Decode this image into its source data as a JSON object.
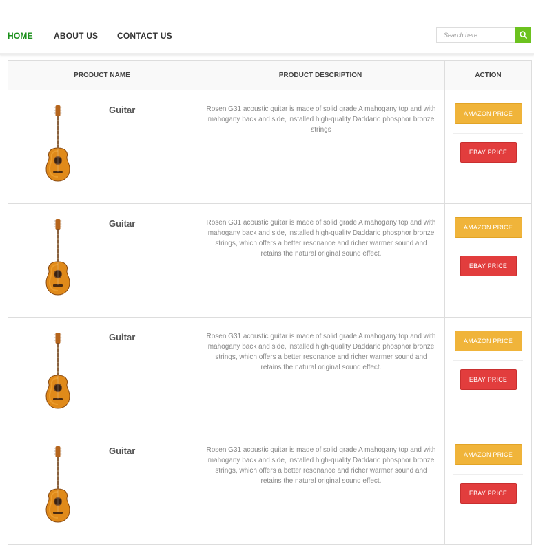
{
  "nav": {
    "items": [
      {
        "label": "HOME",
        "active": true
      },
      {
        "label": "ABOUT US",
        "active": false
      },
      {
        "label": "CONTACT US",
        "active": false
      }
    ],
    "search": {
      "placeholder": "Search here",
      "icon": "search-icon"
    },
    "colors": {
      "active": "#1a8f1a",
      "search_button": "#6cc21f"
    }
  },
  "table": {
    "headers": [
      "PRODUCT NAME",
      "PRODUCT DESCRIPTION",
      "ACTION"
    ],
    "rows": [
      {
        "name": "Guitar",
        "image": "acoustic-guitar-image",
        "description": "Rosen G31 acoustic guitar is made of solid grade A mahogany top and with mahogany back and side, installed high-quality Daddario phosphor bronze strings",
        "amazon_label": "AMAZON PRICE",
        "ebay_label": "EBAY PRICE"
      },
      {
        "name": "Guitar",
        "image": "acoustic-guitar-image",
        "description": "Rosen G31 acoustic guitar is made of solid grade A mahogany top and with mahogany back and side, installed high-quality Daddario phosphor bronze strings, which offers a better resonance and richer warmer sound and retains the natural original sound effect.",
        "amazon_label": "AMAZON PRICE",
        "ebay_label": "EBAY PRICE"
      },
      {
        "name": "Guitar",
        "image": "acoustic-guitar-image",
        "description": "Rosen G31 acoustic guitar is made of solid grade A mahogany top and with mahogany back and side, installed high-quality Daddario phosphor bronze strings, which offers a better resonance and richer warmer sound and retains the natural original sound effect.",
        "amazon_label": "AMAZON PRICE",
        "ebay_label": "EBAY PRICE"
      },
      {
        "name": "Guitar",
        "image": "acoustic-guitar-image",
        "description": "Rosen G31 acoustic guitar is made of solid grade A mahogany top and with mahogany back and side, installed high-quality Daddario phosphor bronze strings, which offers a better resonance and richer warmer sound and retains the natural original sound effect.",
        "amazon_label": "AMAZON PRICE",
        "ebay_label": "EBAY PRICE"
      }
    ],
    "colors": {
      "amazon": "#f0b43a",
      "ebay": "#e23d3d"
    }
  }
}
